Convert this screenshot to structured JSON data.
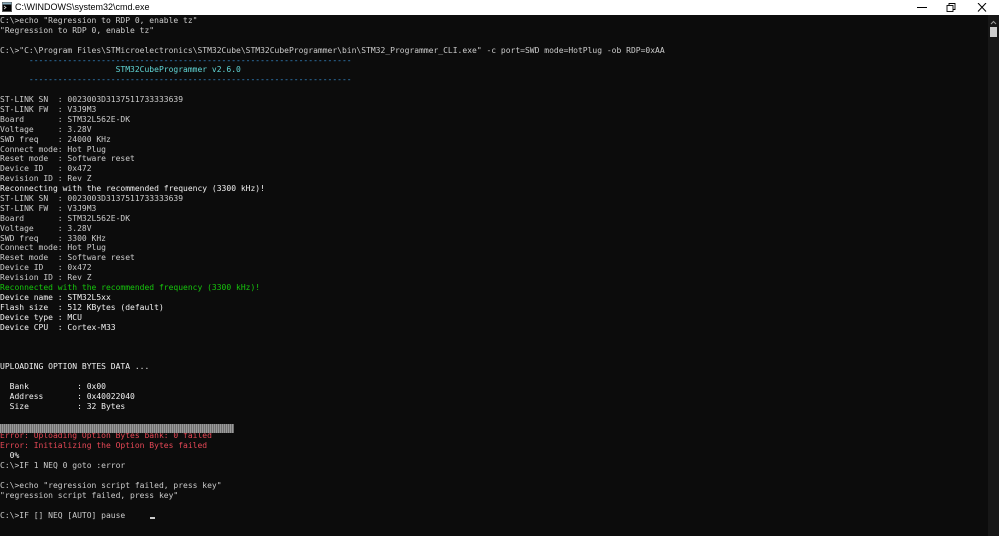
{
  "window": {
    "title": "C:\\WINDOWS\\system32\\cmd.exe",
    "icon": "cmd-icon",
    "controls": [
      "minimize-icon",
      "maximize-icon",
      "close-icon"
    ]
  },
  "console": {
    "lines": [
      {
        "text": "C:\\>echo \"Regression to RDP 0, enable tz\"",
        "color": ""
      },
      {
        "text": "\"Regression to RDP 0, enable tz\"",
        "color": ""
      },
      {
        "text": "",
        "color": ""
      },
      {
        "text": "C:\\>\"C:\\Program Files\\STMicroelectronics\\STM32Cube\\STM32CubeProgrammer\\bin\\STM32_Programmer_CLI.exe\" -c port=SWD mode=HotPlug -ob RDP=0xAA",
        "color": ""
      },
      {
        "text": "      -------------------------------------------------------------------",
        "color": "c-cyan"
      },
      {
        "text": "                        STM32CubeProgrammer v2.6.0",
        "color": "c-cyan2"
      },
      {
        "text": "      -------------------------------------------------------------------",
        "color": "c-cyan"
      },
      {
        "text": "",
        "color": ""
      },
      {
        "text": "ST-LINK SN  : 0023003D3137511733333639",
        "color": ""
      },
      {
        "text": "ST-LINK FW  : V3J9M3",
        "color": ""
      },
      {
        "text": "Board       : STM32L562E-DK",
        "color": ""
      },
      {
        "text": "Voltage     : 3.28V",
        "color": ""
      },
      {
        "text": "SWD freq    : 24000 KHz",
        "color": ""
      },
      {
        "text": "Connect mode: Hot Plug",
        "color": ""
      },
      {
        "text": "Reset mode  : Software reset",
        "color": ""
      },
      {
        "text": "Device ID   : 0x472",
        "color": ""
      },
      {
        "text": "Revision ID : Rev Z",
        "color": ""
      },
      {
        "text": "Reconnecting with the recommended frequency (3300 kHz)!",
        "color": "c-bright"
      },
      {
        "text": "ST-LINK SN  : 0023003D3137511733333639",
        "color": ""
      },
      {
        "text": "ST-LINK FW  : V3J9M3",
        "color": ""
      },
      {
        "text": "Board       : STM32L562E-DK",
        "color": ""
      },
      {
        "text": "Voltage     : 3.28V",
        "color": ""
      },
      {
        "text": "SWD freq    : 3300 KHz",
        "color": ""
      },
      {
        "text": "Connect mode: Hot Plug",
        "color": ""
      },
      {
        "text": "Reset mode  : Software reset",
        "color": ""
      },
      {
        "text": "Device ID   : 0x472",
        "color": ""
      },
      {
        "text": "Revision ID : Rev Z",
        "color": ""
      },
      {
        "text": "Reconnected with the recommended frequency (3300 kHz)!",
        "color": "c-green"
      },
      {
        "text": "Device name : STM32L5xx",
        "color": "c-bright"
      },
      {
        "text": "Flash size  : 512 KBytes (default)",
        "color": "c-bright"
      },
      {
        "text": "Device type : MCU",
        "color": "c-bright"
      },
      {
        "text": "Device CPU  : Cortex-M33",
        "color": "c-bright"
      },
      {
        "text": "",
        "color": ""
      },
      {
        "text": "",
        "color": ""
      },
      {
        "text": "",
        "color": ""
      },
      {
        "text": "UPLOADING OPTION BYTES DATA ...",
        "color": "c-bright"
      },
      {
        "text": "",
        "color": ""
      },
      {
        "text": "  Bank          : 0x00",
        "color": "c-bright"
      },
      {
        "text": "  Address       : 0x40022040",
        "color": "c-bright"
      },
      {
        "text": "  Size          : 32 Bytes",
        "color": "c-bright"
      },
      {
        "text": "",
        "color": ""
      },
      {
        "text": "",
        "color": ""
      },
      {
        "text": "Error: Uploading Option Bytes bank: 0 failed",
        "color": "c-red"
      },
      {
        "text": "Error: Initializing the Option Bytes failed",
        "color": "c-red"
      },
      {
        "text": "  0%",
        "color": "c-bright"
      },
      {
        "text": "C:\\>IF 1 NEQ 0 goto :error",
        "color": ""
      },
      {
        "text": "",
        "color": ""
      },
      {
        "text": "C:\\>echo \"regression script failed, press key\"",
        "color": ""
      },
      {
        "text": "\"regression script failed, press key\"",
        "color": ""
      },
      {
        "text": "",
        "color": ""
      },
      {
        "text": "C:\\>IF [] NEQ [AUTO] pause",
        "color": ""
      }
    ],
    "progress_percent": 0
  },
  "colors": {
    "background": "#0c0c0c",
    "text": "#cccccc",
    "error": "#e74856",
    "success": "#16c60c",
    "banner": "#3a96dd"
  }
}
